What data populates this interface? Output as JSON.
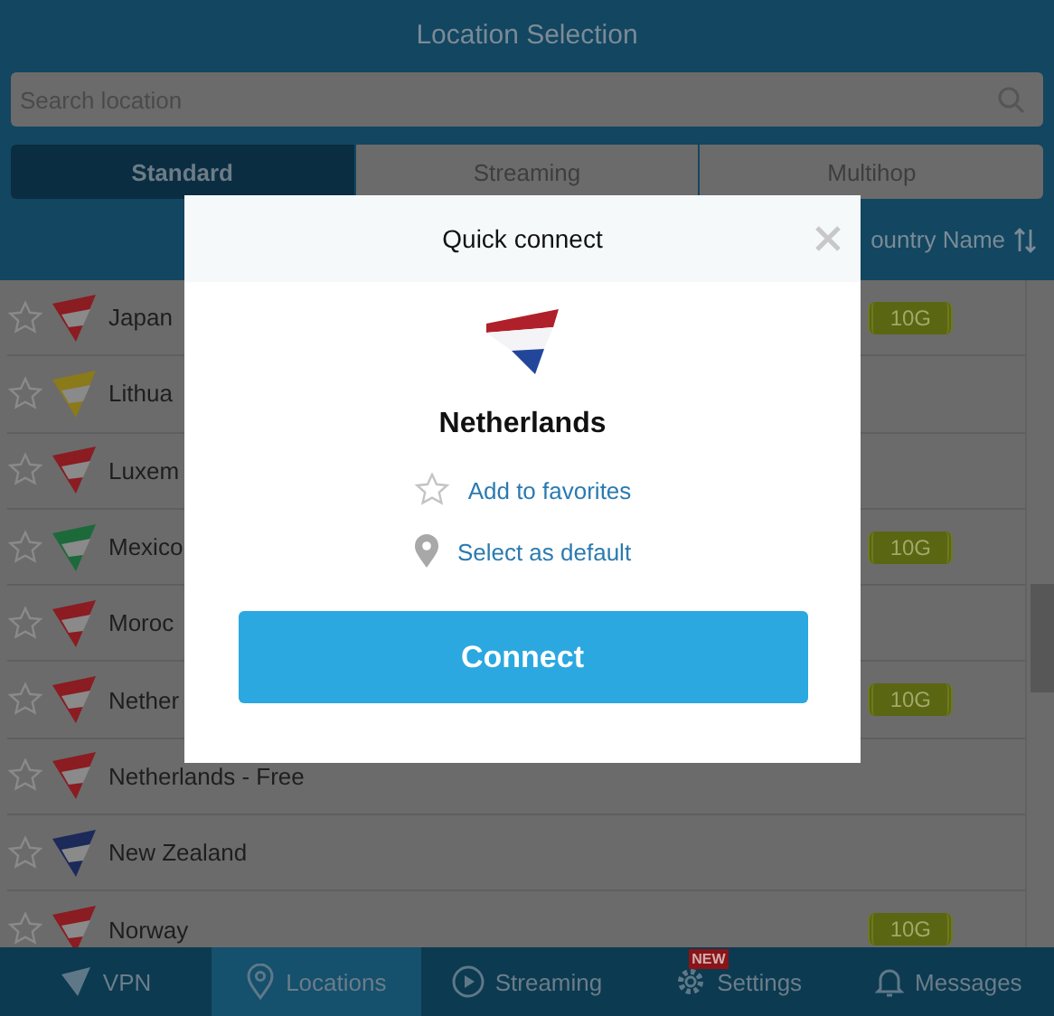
{
  "header": {
    "title": "Location Selection"
  },
  "search": {
    "placeholder": "Search location"
  },
  "tabs": [
    {
      "label": "Standard",
      "selected": true
    },
    {
      "label": "Streaming",
      "selected": false
    },
    {
      "label": "Multihop",
      "selected": false
    }
  ],
  "sort": {
    "label": "ountry Name"
  },
  "rows": [
    {
      "name": "Japan",
      "color": "#8a1c22",
      "badge": "10G"
    },
    {
      "name": "Lithua",
      "color": "#8a7a1a"
    },
    {
      "name": "Luxem",
      "color": "#8a1c22"
    },
    {
      "name": "Mexico",
      "color": "#1c6a3a",
      "badge": "10G"
    },
    {
      "name": "Moroc",
      "color": "#8a1c22"
    },
    {
      "name": "Nether",
      "color": "#8a1c22",
      "badge": "10G"
    },
    {
      "name": "Netherlands - Free",
      "color": "#8a1c22"
    },
    {
      "name": "New Zealand",
      "color": "#1c2a5a"
    },
    {
      "name": "Norway",
      "color": "#8a1c22",
      "badge": "10G"
    }
  ],
  "nav": [
    {
      "label": "VPN",
      "kind": "vpn",
      "selected": false
    },
    {
      "label": "Locations",
      "kind": "locations",
      "selected": true
    },
    {
      "label": "Streaming",
      "kind": "streaming",
      "selected": false
    },
    {
      "label": "Settings",
      "kind": "settings",
      "selected": false,
      "badge": "NEW"
    },
    {
      "label": "Messages",
      "kind": "messages",
      "selected": false
    }
  ],
  "modal": {
    "title": "Quick connect",
    "country": "Netherlands",
    "actions": [
      {
        "kind": "favorite",
        "label": "Add to favorites"
      },
      {
        "kind": "default",
        "label": "Select as default"
      }
    ],
    "button": "Connect"
  }
}
